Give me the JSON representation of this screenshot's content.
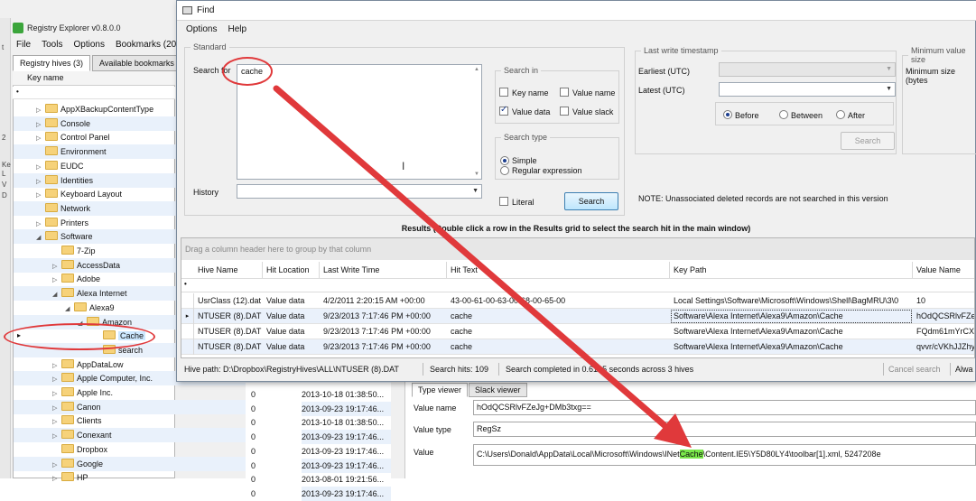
{
  "registry": {
    "title": "Registry Explorer v0.8.0.0",
    "menu": [
      "File",
      "Tools",
      "Options",
      "Bookmarks (20/"
    ],
    "tabs": [
      "Registry hives (3)",
      "Available bookmarks"
    ],
    "key_name_header": "Key name",
    "filter_glyph": "•",
    "left_strip": [
      "t",
      "2",
      "Ke",
      "L",
      "V",
      "D"
    ],
    "tree": [
      {
        "label": "AppXBackupContentType",
        "expand": "▷"
      },
      {
        "label": "Console",
        "expand": "▷"
      },
      {
        "label": "Control Panel",
        "expand": "▷"
      },
      {
        "label": "Environment",
        "expand": ""
      },
      {
        "label": "EUDC",
        "expand": "▷"
      },
      {
        "label": "Identities",
        "expand": "▷"
      },
      {
        "label": "Keyboard Layout",
        "expand": "▷"
      },
      {
        "label": "Network",
        "expand": ""
      },
      {
        "label": "Printers",
        "expand": "▷"
      },
      {
        "label": "Software",
        "expand": "◢"
      },
      {
        "label": "7-Zip",
        "expand": ""
      },
      {
        "label": "AccessData",
        "expand": "▷"
      },
      {
        "label": "Adobe",
        "expand": "▷"
      },
      {
        "label": "Alexa Internet",
        "expand": "◢"
      },
      {
        "label": "Alexa9",
        "expand": "◢"
      },
      {
        "label": "Amazon",
        "expand": "◢"
      },
      {
        "label": "Cache",
        "expand": ""
      },
      {
        "label": "search",
        "expand": ""
      },
      {
        "label": "AppDataLow",
        "expand": "▷"
      },
      {
        "label": "Apple Computer, Inc.",
        "expand": "▷"
      },
      {
        "label": "Apple Inc.",
        "expand": "▷"
      },
      {
        "label": "Canon",
        "expand": "▷"
      },
      {
        "label": "Clients",
        "expand": "▷"
      },
      {
        "label": "Conexant",
        "expand": "▷"
      },
      {
        "label": "Dropbox",
        "expand": ""
      },
      {
        "label": "Google",
        "expand": "▷"
      },
      {
        "label": "HP",
        "expand": "▷"
      }
    ],
    "row_marker": "▸",
    "lower_rows": [
      {
        "count": "0",
        "time": "2013-10-18 01:38:50..."
      },
      {
        "count": "0",
        "time": "2013-09-23 19:17:46..."
      },
      {
        "count": "0",
        "time": "2013-10-18 01:38:50..."
      },
      {
        "count": "0",
        "time": "2013-09-23 19:17:46..."
      },
      {
        "count": "0",
        "time": "2013-09-23 19:17:46..."
      },
      {
        "count": "0",
        "time": "2013-09-23 19:17:46..."
      },
      {
        "count": "0",
        "time": "2013-08-01 19:21:56..."
      },
      {
        "count": "0",
        "time": "2013-09-23 19:17:46..."
      }
    ],
    "value_tabs": [
      "Type viewer",
      "Slack viewer"
    ],
    "value_name_label": "Value name",
    "value_name": "hOdQCSRlvFZeJg+DMb3txg==",
    "value_type_label": "Value type",
    "value_type": "RegSz",
    "value_label": "Value",
    "value_pre": "C:\\Users\\Donald\\AppData\\Local\\Microsoft\\Windows\\INet",
    "value_hl": "Cache",
    "value_post": "\\Content.IE5\\Y5D80LY4\\toolbar[1].xml, 5247208e"
  },
  "find": {
    "title": "Find",
    "menu": [
      "Options",
      "Help"
    ],
    "standard_legend": "Standard",
    "search_for_label": "Search for",
    "search_for_value": "cache",
    "history_label": "History",
    "search_in_legend": "Search in",
    "chk_key_name": "Key name",
    "chk_value_name": "Value name",
    "chk_value_data": "Value data",
    "chk_value_slack": "Value slack",
    "search_type_legend": "Search type",
    "radio_simple": "Simple",
    "radio_regex": "Regular expression",
    "chk_literal": "Literal",
    "search_button": "Search",
    "lw_legend": "Last write timestamp",
    "earliest_label": "Earliest (UTC)",
    "latest_label": "Latest (UTC)",
    "radio_before": "Before",
    "radio_between": "Between",
    "radio_after": "After",
    "lw_search_button": "Search",
    "minval_legend": "Minimum value size",
    "minsize_label": "Minimum size (bytes",
    "note": "NOTE: Unassociated deleted records are not searched in this version",
    "results_header": "Results (Double click a row in the Results grid to select the search hit in the main window)",
    "group_hint": "Drag a column header here to group by that column",
    "filter_glyph": "•",
    "row_marker": "▸",
    "columns": [
      "Hive Name",
      "Hit Location",
      "Last Write Time",
      "Hit Text",
      "Key Path",
      "Value Name"
    ],
    "rows": [
      {
        "hive": "UsrClass (12).dat",
        "loc": "Value data",
        "time": "4/2/2011 2:20:15 AM +00:00",
        "hit": "43-00-61-00-63-00-68-00-65-00",
        "key": "Local Settings\\Software\\Microsoft\\Windows\\Shell\\BagMRU\\3\\0",
        "val": "10"
      },
      {
        "hive": "NTUSER (8).DAT",
        "loc": "Value data",
        "time": "9/23/2013 7:17:46 PM +00:00",
        "hit": "cache",
        "key": "Software\\Alexa Internet\\Alexa9\\Amazon\\Cache",
        "val": "hOdQCSRlvFZeJ"
      },
      {
        "hive": "NTUSER (8).DAT",
        "loc": "Value data",
        "time": "9/23/2013 7:17:46 PM +00:00",
        "hit": "cache",
        "key": "Software\\Alexa Internet\\Alexa9\\Amazon\\Cache",
        "val": "FQdm61mYrCXr"
      },
      {
        "hive": "NTUSER (8).DAT",
        "loc": "Value data",
        "time": "9/23/2013 7:17:46 PM +00:00",
        "hit": "cache",
        "key": "Software\\Alexa Internet\\Alexa9\\Amazon\\Cache",
        "val": "qvvr/cVKhJJZhy"
      }
    ],
    "status_hive": "Hive path: D:\\Dropbox\\RegistryHives\\ALL\\NTUSER (8).DAT",
    "status_hits": "Search hits: 109",
    "status_completed": "Search completed in 0.6135 seconds across 3 hives",
    "status_cancel": "Cancel search",
    "status_always": "Alwa"
  },
  "colors": {
    "annotation": "#e0393b",
    "highlight": "#7ae84a",
    "selection": "#cde8ff"
  }
}
